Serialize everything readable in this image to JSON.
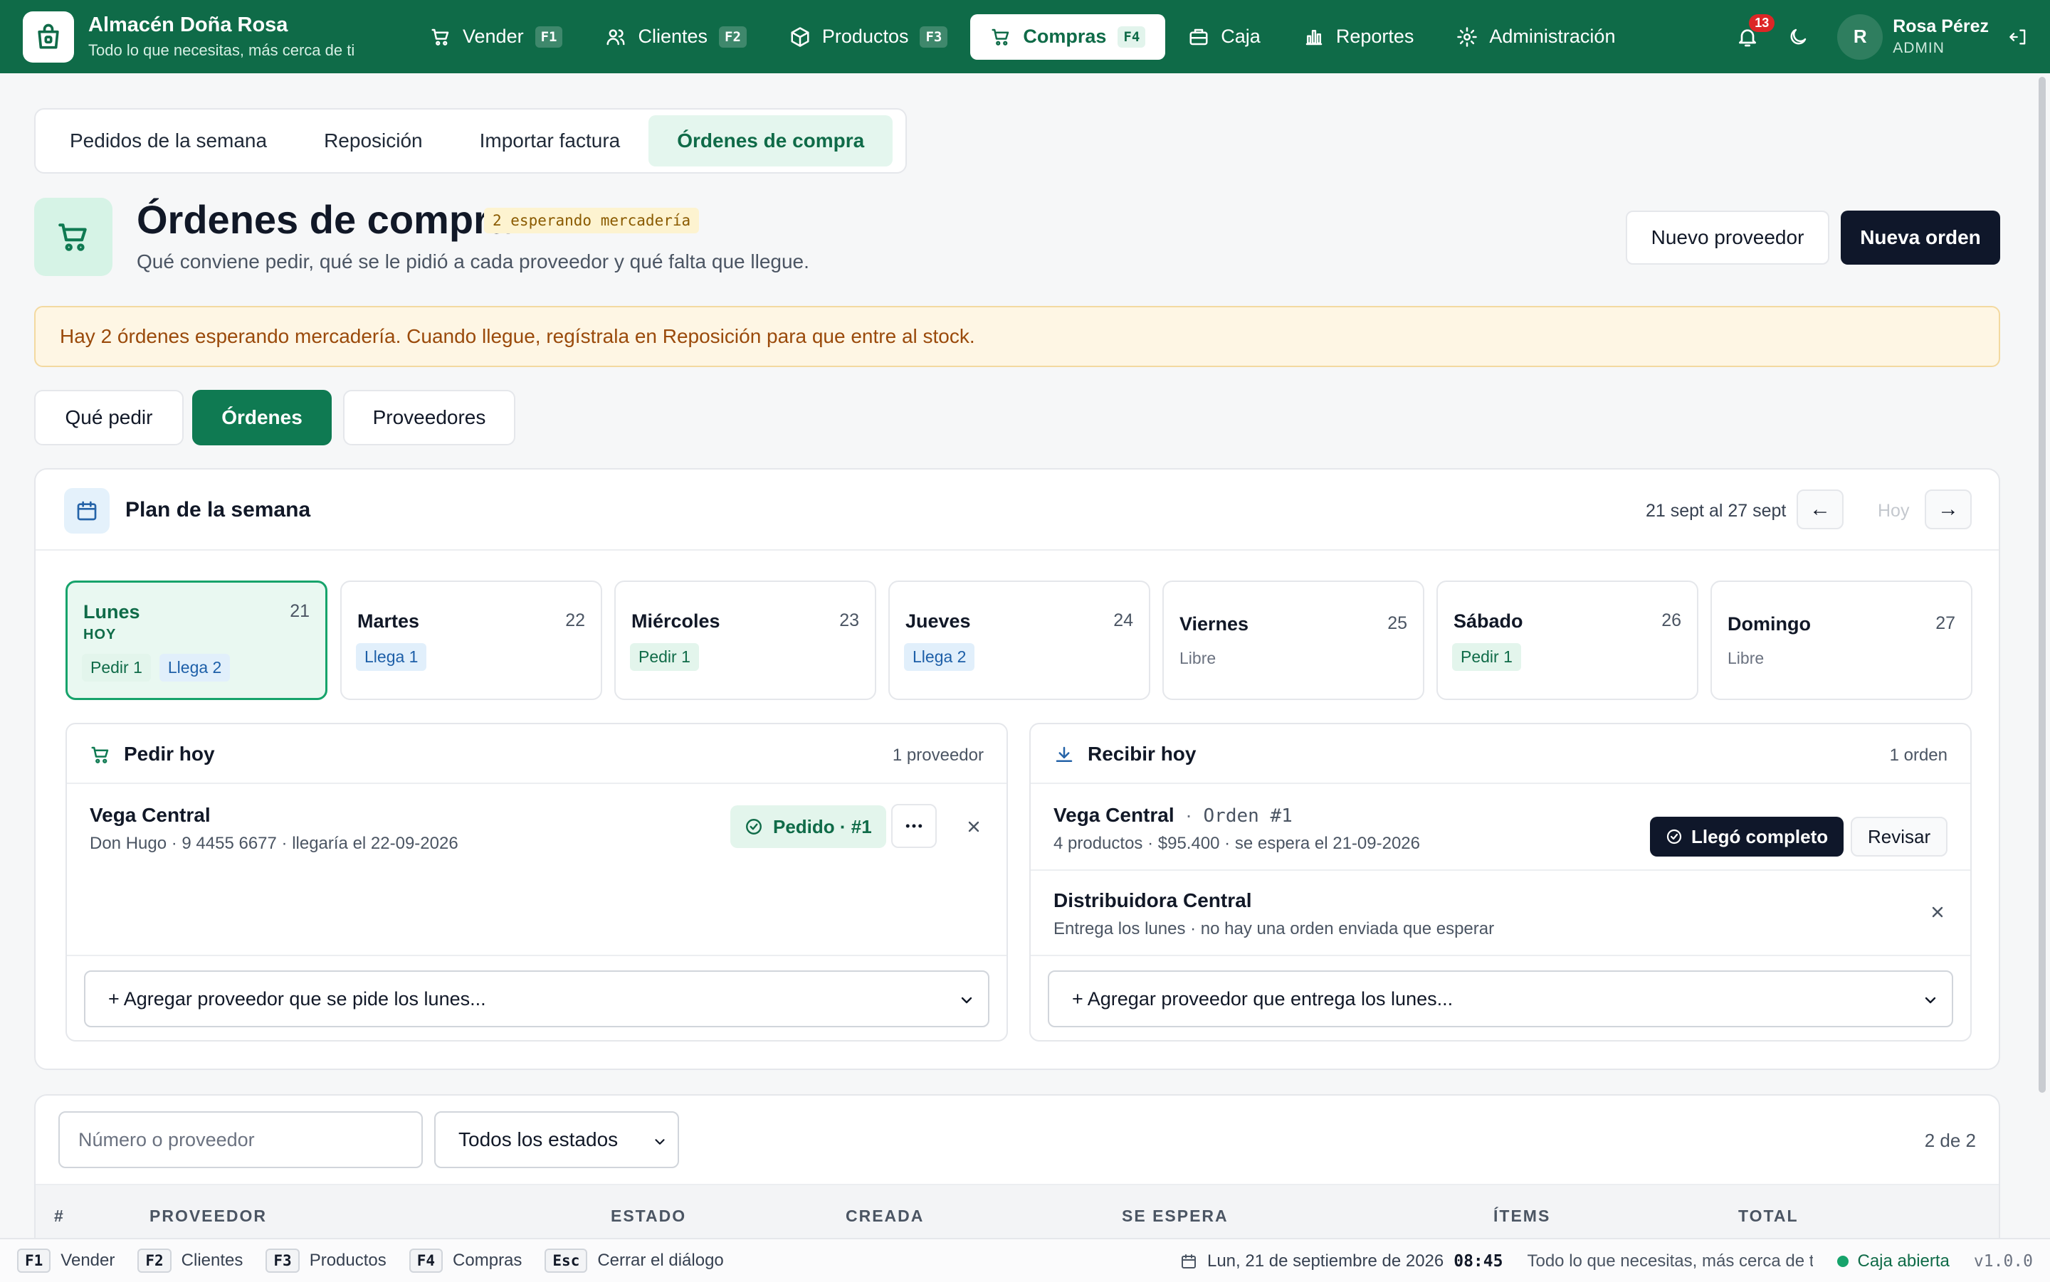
{
  "app": {
    "name": "Almacén Doña Rosa",
    "tagline": "Todo lo que necesitas, más cerca de ti"
  },
  "nav": {
    "items": [
      {
        "label": "Vender",
        "key": "F1",
        "icon": "cart-icon"
      },
      {
        "label": "Clientes",
        "key": "F2",
        "icon": "users-icon"
      },
      {
        "label": "Productos",
        "key": "F3",
        "icon": "box-icon"
      },
      {
        "label": "Compras",
        "key": "F4",
        "icon": "basket-icon",
        "active": true
      },
      {
        "label": "Caja",
        "icon": "register-icon"
      },
      {
        "label": "Reportes",
        "icon": "bar-chart-icon"
      },
      {
        "label": "Administración",
        "icon": "settings-icon"
      }
    ]
  },
  "user": {
    "notifications": "13",
    "initial": "R",
    "name": "Rosa Pérez",
    "role": "ADMIN"
  },
  "subtabs": [
    "Pedidos de la semana",
    "Reposición",
    "Importar factura",
    "Órdenes de compra"
  ],
  "header": {
    "title": "Órdenes de compra",
    "badge": "2 esperando mercadería",
    "subtitle": "Qué conviene pedir, qué se le pidió a cada proveedor y qué falta que llegue.",
    "new_supplier": "Nuevo proveedor",
    "new_order": "Nueva orden"
  },
  "alert": "Hay 2 órdenes esperando mercadería. Cuando llegue, regístrala en Reposición para que entre al stock.",
  "segments": [
    "Qué pedir",
    "Órdenes",
    "Proveedores"
  ],
  "plan": {
    "title": "Plan de la semana",
    "range": "21 sept al 27 sept",
    "prev": "←",
    "today": "Hoy",
    "next": "→",
    "days": [
      {
        "name": "Lunes",
        "num": "21",
        "today_label": "HOY",
        "pedir": "Pedir 1",
        "llega": "Llega 2"
      },
      {
        "name": "Martes",
        "num": "22",
        "llega": "Llega 1"
      },
      {
        "name": "Miércoles",
        "num": "23",
        "pedir": "Pedir 1"
      },
      {
        "name": "Jueves",
        "num": "24",
        "llega": "Llega 2"
      },
      {
        "name": "Viernes",
        "num": "25",
        "libre": "Libre"
      },
      {
        "name": "Sábado",
        "num": "26",
        "pedir": "Pedir 1"
      },
      {
        "name": "Domingo",
        "num": "27",
        "libre": "Libre"
      }
    ],
    "order_today": {
      "title": "Pedir hoy",
      "count": "1 proveedor",
      "supplier": "Vega Central",
      "detail": "Don Hugo · 9 4455 6677 · llegaría el 22-09-2026",
      "status": "Pedido · #1",
      "add": "+ Agregar proveedor que se pide los lunes..."
    },
    "receive_today": {
      "title": "Recibir hoy",
      "count": "1 orden",
      "supplier": "Vega Central",
      "order_ref": "Orden #1",
      "detail": "4 productos · $95.400 · se espera el 21-09-2026",
      "complete": "Llegó completo",
      "review": "Revisar",
      "supplier2": "Distribuidora Central",
      "detail2": "Entrega los lunes · no hay una orden enviada que esperar",
      "add": "+ Agregar proveedor que entrega los lunes..."
    }
  },
  "orders": {
    "search_placeholder": "Número o proveedor",
    "status_filter": "Todos los estados",
    "results": "2 de 2",
    "columns": [
      "#",
      "PROVEEDOR",
      "ESTADO",
      "CREADA",
      "SE ESPERA",
      "ÍTEMS",
      "TOTAL"
    ]
  },
  "footer": {
    "shortcuts": [
      {
        "key": "F1",
        "label": "Vender"
      },
      {
        "key": "F2",
        "label": "Clientes"
      },
      {
        "key": "F3",
        "label": "Productos"
      },
      {
        "key": "F4",
        "label": "Compras"
      },
      {
        "key": "Esc",
        "label": "Cerrar el diálogo"
      }
    ],
    "date": "Lun, 21 de septiembre de 2026",
    "time": "08:45",
    "tagline": "Todo lo que necesitas, más cerca de ti",
    "register": "Caja abierta",
    "version": "v1.0.0"
  },
  "colors": {
    "brand": "#0f6b48",
    "accent": "#0f7a52",
    "dark": "#0f172a",
    "warning_bg": "#fef6e4"
  }
}
